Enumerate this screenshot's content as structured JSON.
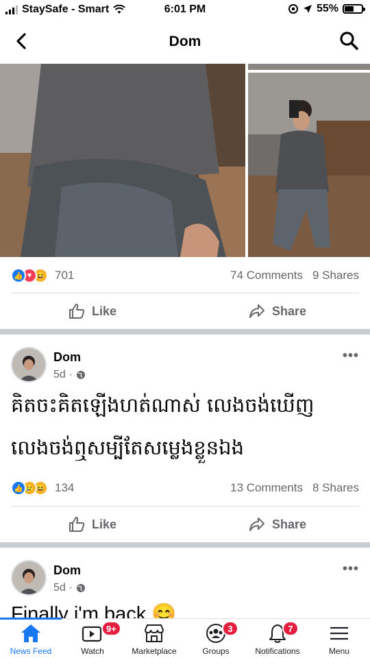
{
  "status_bar": {
    "carrier": "StaySafe - Smart",
    "time": "6:01 PM",
    "battery_percent": "55%",
    "battery_level": 0.55
  },
  "header": {
    "title": "Dom",
    "back_icon": "chevron-left-icon",
    "search_icon": "search-icon"
  },
  "post1": {
    "reactions": [
      "like",
      "love",
      "haha"
    ],
    "reaction_count": "701",
    "comments": "74 Comments",
    "shares": "9 Shares",
    "like_label": "Like",
    "share_label": "Share"
  },
  "post2": {
    "author": "Dom",
    "time": "5d",
    "privacy_icon": "globe-icon",
    "text_line1": "គិតចះគិតឡើងហត់ណាស់ លេងចង់ឃើញ",
    "text_line2": "លេងចង់ឮសម្បីតែសម្លេងខ្លួនឯង",
    "reactions": [
      "like",
      "sad",
      "haha"
    ],
    "reaction_count": "134",
    "comments": "13 Comments",
    "shares": "8 Shares",
    "like_label": "Like",
    "share_label": "Share"
  },
  "post3": {
    "author": "Dom",
    "time": "5d",
    "text": "Finally i'm back 😊"
  },
  "bottom_nav": {
    "items": [
      {
        "label": "News Feed",
        "icon": "home-icon",
        "active": true
      },
      {
        "label": "Watch",
        "icon": "watch-icon",
        "badge": "9+"
      },
      {
        "label": "Marketplace",
        "icon": "marketplace-icon"
      },
      {
        "label": "Groups",
        "icon": "groups-icon",
        "badge": "3"
      },
      {
        "label": "Notifications",
        "icon": "bell-icon",
        "badge": "7"
      },
      {
        "label": "Menu",
        "icon": "menu-icon"
      }
    ]
  },
  "colors": {
    "accent": "#1877f2",
    "badge": "#e41e3f",
    "separator": "#c9ccd1"
  }
}
